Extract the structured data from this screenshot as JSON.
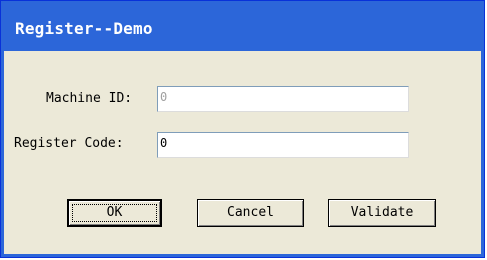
{
  "window": {
    "title": "Register--Demo"
  },
  "form": {
    "machine_id_label": "Machine ID:",
    "machine_id_value": "0",
    "register_code_label": "Register Code:",
    "register_code_value": "0"
  },
  "buttons": {
    "ok_label": "OK",
    "cancel_label": "Cancel",
    "validate_label": "Validate"
  },
  "colors": {
    "titlebar": "#2c66d9",
    "dialog_background": "#ece9d8"
  }
}
